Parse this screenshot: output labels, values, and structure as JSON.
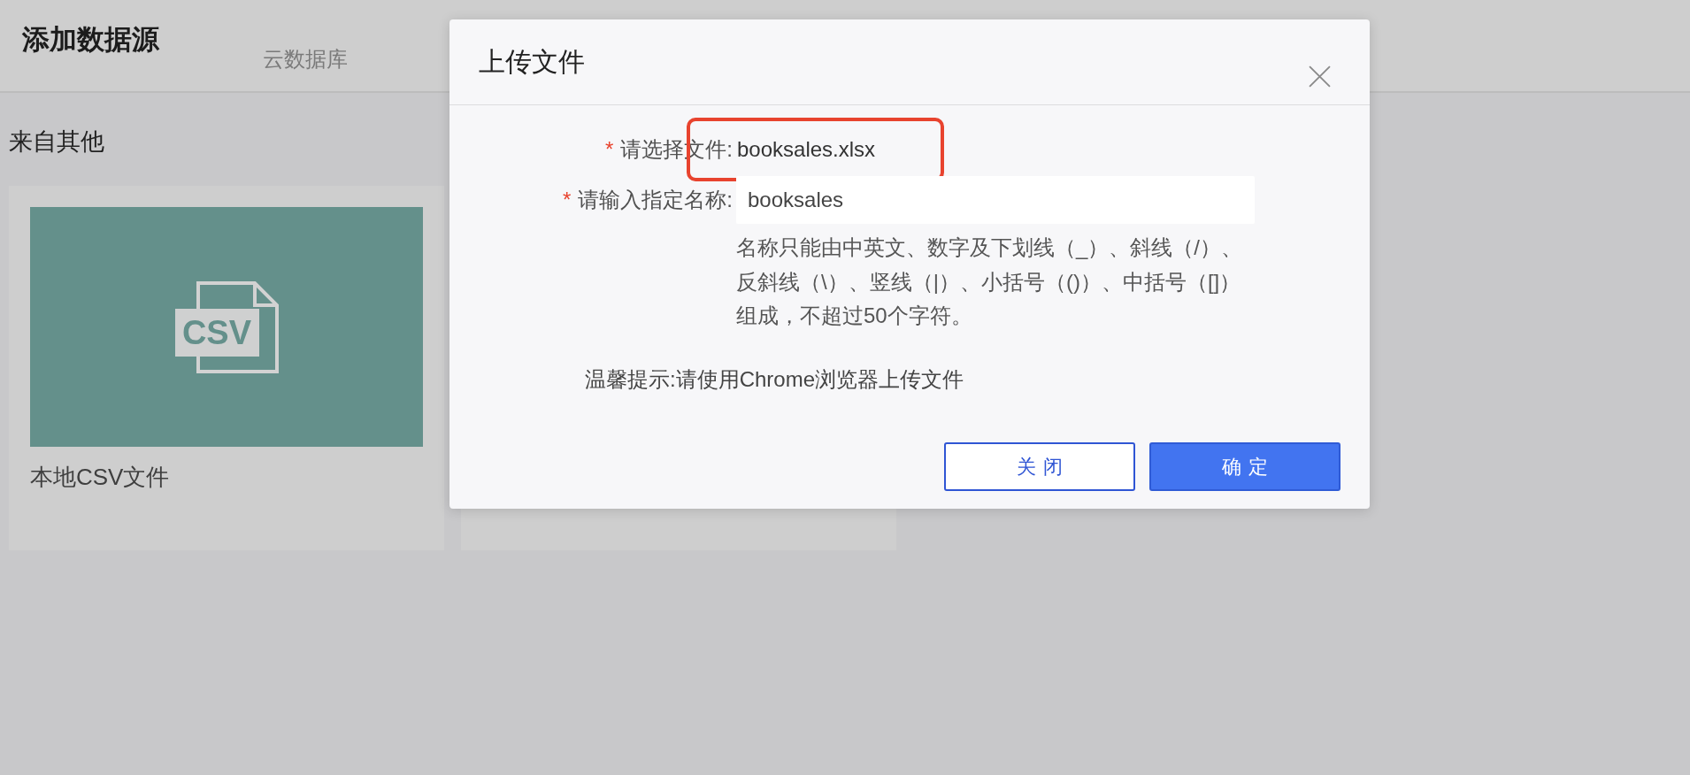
{
  "page": {
    "title": "添加数据源",
    "tabs": [
      {
        "label": "云数据库",
        "selected": false
      }
    ],
    "section_title": "来自其他",
    "cards": [
      {
        "kind": "file",
        "label": "本地CSV文件",
        "icon_label": "CSV"
      },
      {
        "kind": "covered"
      }
    ]
  },
  "dialog": {
    "title": "上传文件",
    "fields": [
      {
        "kind": "static",
        "required_mark": "*",
        "label": "请选择文件:",
        "value": "booksales.xlsx",
        "highlighted": true
      },
      {
        "kind": "input",
        "required_mark": "*",
        "label": "请输入指定名称:",
        "value": "booksales",
        "hint": "名称只能由中英文、数字及下划线（_）、斜线（/）、反斜线（\\）、竖线（|）、小括号（()）、中括号（[]）组成，不超过50个字符。"
      }
    ],
    "tip": "温馨提示:请使用Chrome浏览器上传文件",
    "buttons": [
      {
        "kind": "secondary",
        "label": "关闭"
      },
      {
        "kind": "primary",
        "label": "确定"
      }
    ]
  }
}
